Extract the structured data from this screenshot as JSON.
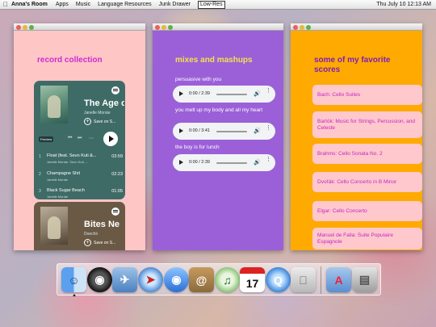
{
  "menubar": {
    "app_name": "Anna's Room",
    "menus": [
      "Apps",
      "Music",
      "Language Resources",
      "Junk Drawer"
    ],
    "lowres_label": "Low-Res",
    "clock": "Thu July 10  12:13 AM"
  },
  "record_window": {
    "heading": "record collection",
    "album1": {
      "title": "The Age o",
      "artist": "Janelle Monáe",
      "save_label": "Save on S...",
      "preview_label": "Preview",
      "tracks": [
        {
          "num": "1",
          "name": "Float (feat. Seun Kuti &...",
          "sub": "Janelle Monáe, Seun Kuti, ...",
          "duration": "03:59"
        },
        {
          "num": "2",
          "name": "Champagne Shit",
          "sub": "Janelle Monáe",
          "duration": "02:23"
        },
        {
          "num": "3",
          "name": "Black Sugar Beach",
          "sub": "Janelle Monáe",
          "duration": "01:05"
        }
      ]
    },
    "album2": {
      "title": "Bites Ne",
      "artist": "Doechii",
      "save_label": "Save on S..."
    }
  },
  "mixes_window": {
    "heading": "mixes and mashups",
    "mixes": [
      {
        "label": "persuasive with you",
        "time": "0:00 / 2:39"
      },
      {
        "label": "you melt up my body and all my heart",
        "time": "0:00 / 3:41"
      },
      {
        "label": "the boy is for lunch",
        "time": "0:00 / 2:39"
      }
    ]
  },
  "scores_window": {
    "heading": "some of my favorite scores",
    "scores": [
      "Bach: Cello Suites",
      "Bartók: Music for Strings, Percussion, and Celeste",
      "Brahms: Cello Sonata No. 2",
      "Dvořák: Cello Concerto in B Minor",
      "Elgar: Cello Concerto",
      "Manuel de Falla: Suite Populaire Espagnole"
    ]
  },
  "dock": {
    "calendar_day": "17",
    "items": [
      "finder-icon",
      "dashboard-icon",
      "mail-icon",
      "safari-icon",
      "ichat-icon",
      "address-book-icon",
      "itunes-icon",
      "ical-icon",
      "quicktime-icon",
      "system-preferences-icon",
      "applications-folder-icon",
      "trash-icon"
    ]
  }
}
